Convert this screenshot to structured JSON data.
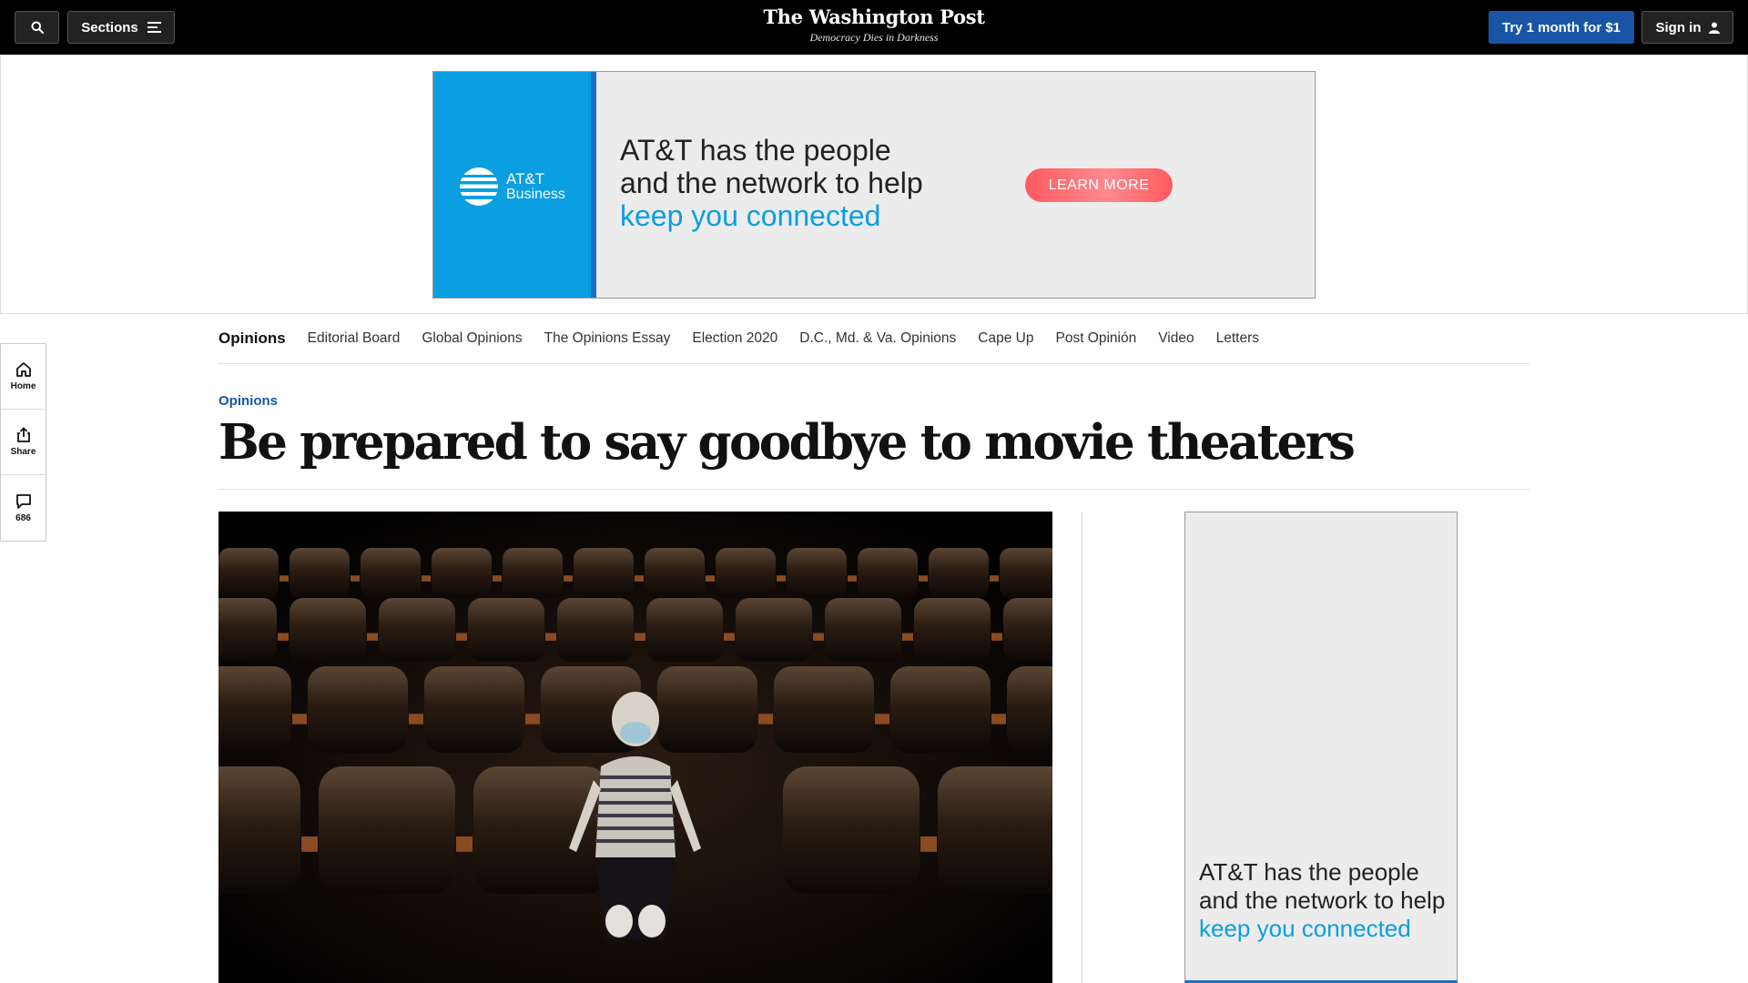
{
  "header": {
    "sections_label": "Sections",
    "logo": "The Washington Post",
    "tagline": "Democracy Dies in Darkness",
    "trial_label": "Try 1 month for $1",
    "signin_label": "Sign in",
    "icons": {
      "search": "search-icon",
      "menu": "hamburger-icon",
      "user": "user-icon"
    }
  },
  "top_ad": {
    "brand_line1": "AT&T",
    "brand_line2": "Business",
    "line1": "AT&T has the people",
    "line2": "and the network to help",
    "line3": "keep you connected",
    "cta": "LEARN MORE",
    "colors": {
      "brand_blue": "#0b9ee0",
      "cta": "#ff5a5f"
    }
  },
  "rail": {
    "home": "Home",
    "share": "Share",
    "comments": "686"
  },
  "section_nav": [
    "Opinions",
    "Editorial Board",
    "Global Opinions",
    "The Opinions Essay",
    "Election 2020",
    "D.C., Md. & Va. Opinions",
    "Cape Up",
    "Post Opinión",
    "Video",
    "Letters"
  ],
  "article": {
    "kicker": "Opinions",
    "headline": "Be prepared to say goodbye to movie theaters"
  },
  "side_ad": {
    "line1": "AT&T has the people",
    "line2": "and the network to help",
    "line3": "keep you connected"
  },
  "colors": {
    "topbar": "#000000",
    "accent": "#1955a5"
  }
}
